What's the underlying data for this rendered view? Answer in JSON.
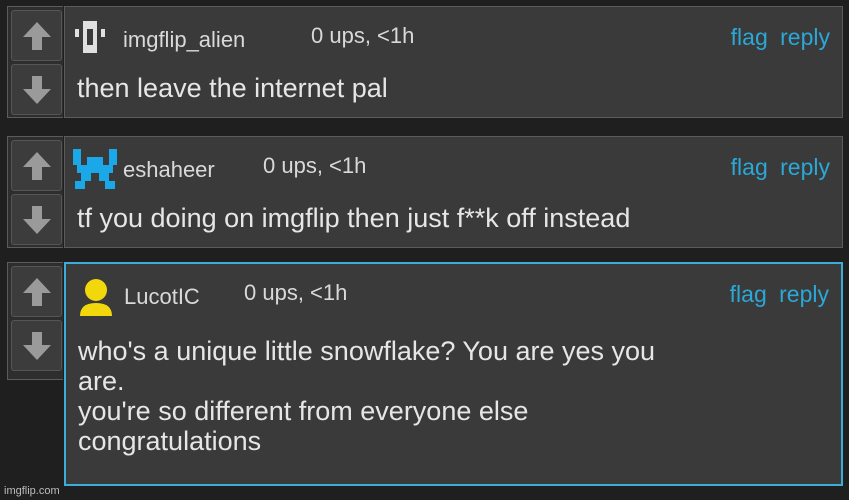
{
  "comments": [
    {
      "username": "imgflip_alien",
      "meta": "0 ups, <1h",
      "flag": "flag",
      "reply": "reply",
      "text": "then leave the internet pal",
      "avatar": "alien-avatar-icon"
    },
    {
      "username": "eshaheer",
      "meta": "0 ups, <1h",
      "flag": "flag",
      "reply": "reply",
      "text": "tf you doing on imgflip then just f**k off instead",
      "avatar": "pixel-avatar-icon"
    },
    {
      "username": "LucotIC",
      "meta": "0 ups, <1h",
      "flag": "flag",
      "reply": "reply",
      "text_lines": [
        "who's a unique little snowflake? You are yes you",
        "are.",
        "you're so different from everyone else",
        "congratulations"
      ],
      "avatar": "default-user-avatar-icon"
    }
  ],
  "watermark": "imgflip.com",
  "colors": {
    "accent": "#2aa8d8",
    "avatar_yellow": "#f2d80a",
    "avatar_cyan": "#1aa8e8"
  }
}
